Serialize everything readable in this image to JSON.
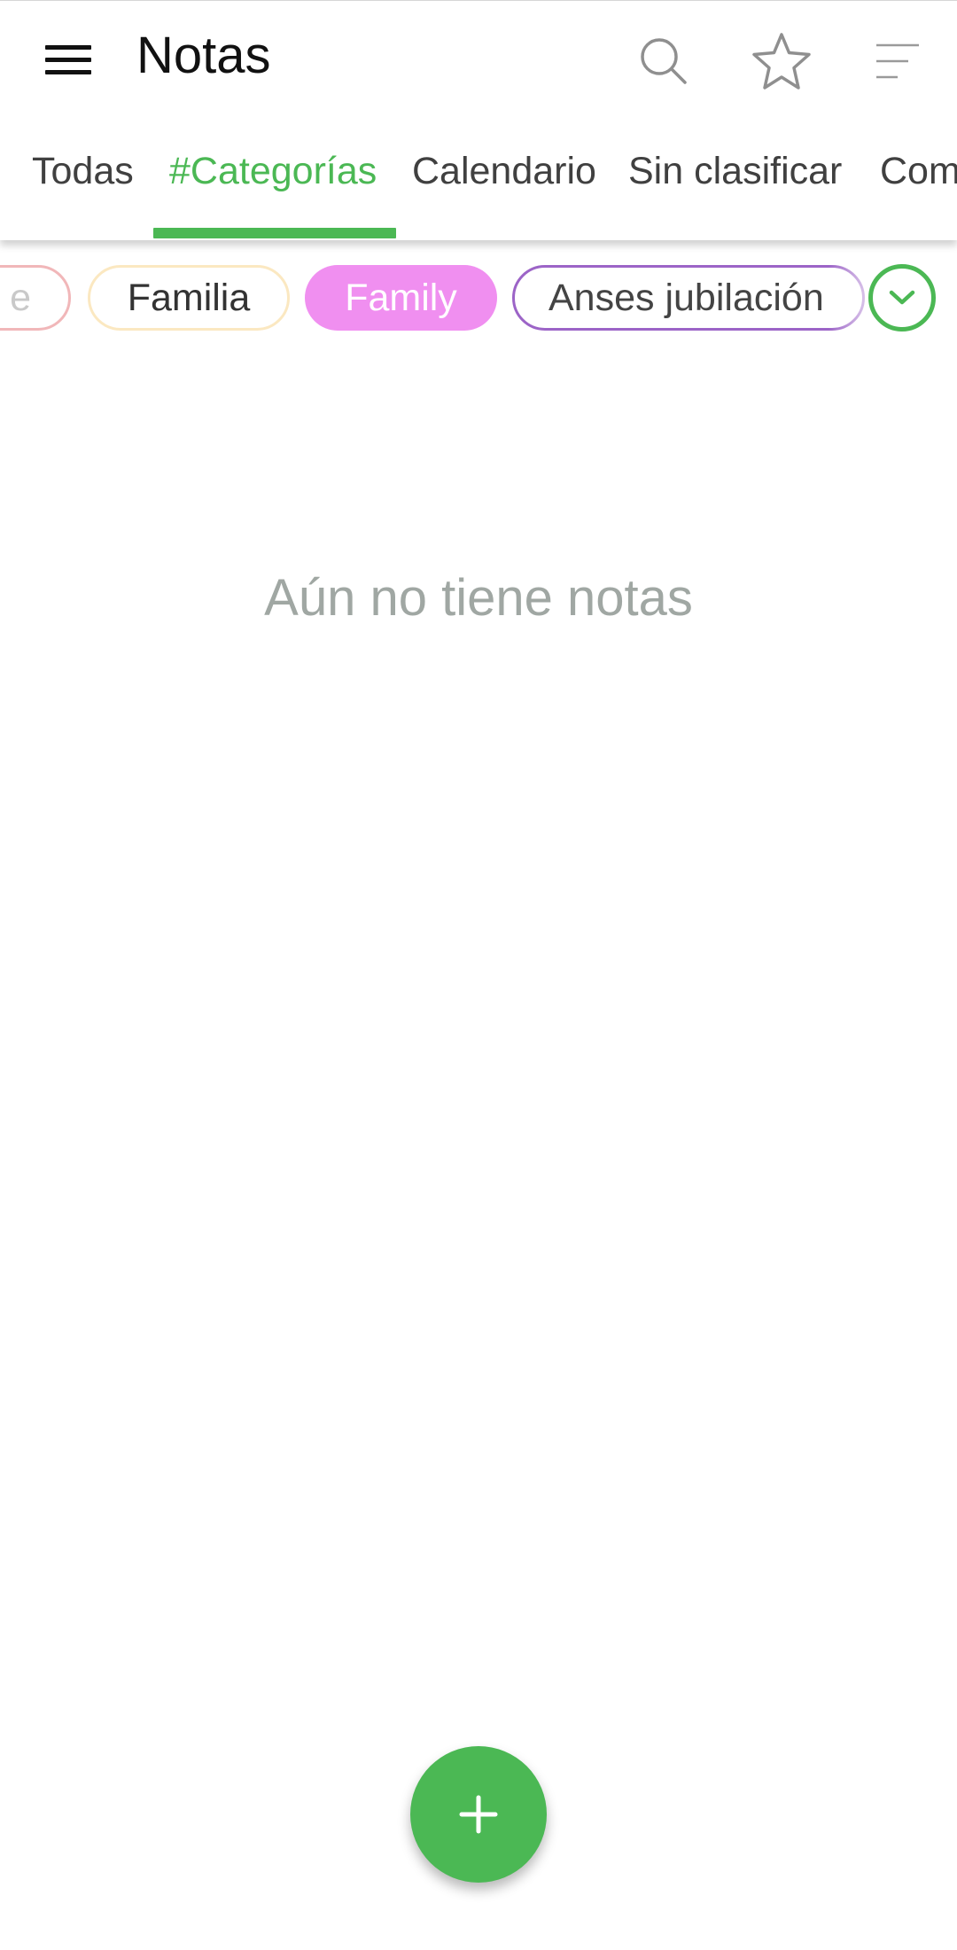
{
  "app_bar": {
    "title": "Notas",
    "menu_icon": "hamburger-menu-icon",
    "actions": [
      {
        "name": "search",
        "icon": "search-icon"
      },
      {
        "name": "favorites",
        "icon": "star-icon"
      },
      {
        "name": "sort",
        "icon": "sort-icon"
      }
    ]
  },
  "tabs": [
    {
      "label": "Todas",
      "active": false
    },
    {
      "label": "#Categorías",
      "active": true
    },
    {
      "label": "Calendario",
      "active": false
    },
    {
      "label": "Sin clasificar",
      "active": false
    },
    {
      "label": "Com",
      "active": false
    }
  ],
  "category_chips": [
    {
      "label": "e",
      "selected": false,
      "color": "#f1b7b9"
    },
    {
      "label": "Familia",
      "selected": false,
      "color": "#fbe8c1"
    },
    {
      "label": "Family",
      "selected": true,
      "color": "#f08ff0"
    },
    {
      "label": "Anses jubilación",
      "selected": false,
      "color": "#9c64c7"
    }
  ],
  "chip_expand_icon": "chevron-down-icon",
  "empty_state": {
    "message": "Aún no tiene notas"
  },
  "fab": {
    "icon": "plus-icon"
  },
  "colors": {
    "accent": "#4bb854",
    "background": "#ffffff",
    "empty_text": "#a0a7a3"
  }
}
